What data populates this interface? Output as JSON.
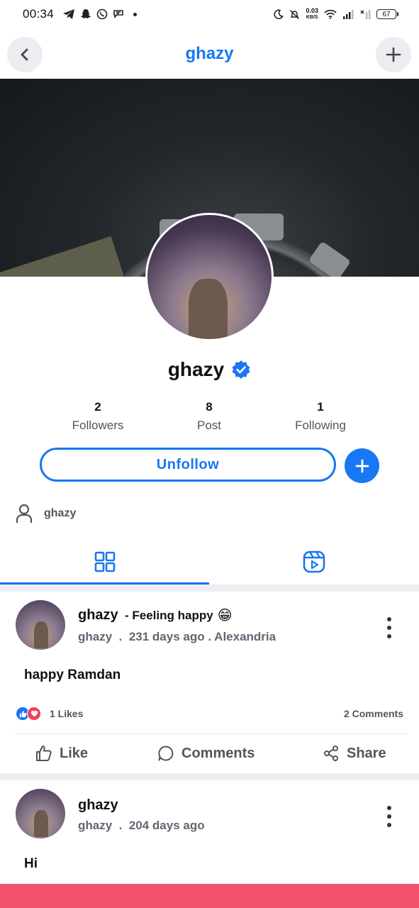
{
  "status_bar": {
    "time": "00:34",
    "net_speed_value": "0.03",
    "net_speed_unit": "KB/S",
    "battery": "67"
  },
  "header": {
    "title": "ghazy"
  },
  "profile": {
    "name": "ghazy",
    "verified": true,
    "stats": [
      {
        "value": "2",
        "label": "Followers"
      },
      {
        "value": "8",
        "label": "Post"
      },
      {
        "value": "1",
        "label": "Following"
      }
    ],
    "unfollow_label": "Unfollow",
    "about_name": "ghazy"
  },
  "tabs": [
    {
      "icon": "grid-icon",
      "active": true
    },
    {
      "icon": "reels-icon",
      "active": false
    }
  ],
  "posts": [
    {
      "author": "ghazy",
      "feeling": "- Feeling happy",
      "feeling_emoji": "😁",
      "meta_user": "ghazy",
      "meta_time": "231 days ago",
      "meta_location": "Alexandria",
      "meta_sep": ".",
      "text": "happy Ramdan",
      "likes": "1 Likes",
      "comments": "2 Comments"
    },
    {
      "author": "ghazy",
      "meta_user": "ghazy",
      "meta_time": "204 days ago",
      "meta_sep": ".",
      "text": "Hi"
    }
  ],
  "actions": {
    "like": "Like",
    "comments": "Comments",
    "share": "Share"
  },
  "colors": {
    "accent": "#1877f2",
    "bottom_bar": "#f4516c"
  }
}
